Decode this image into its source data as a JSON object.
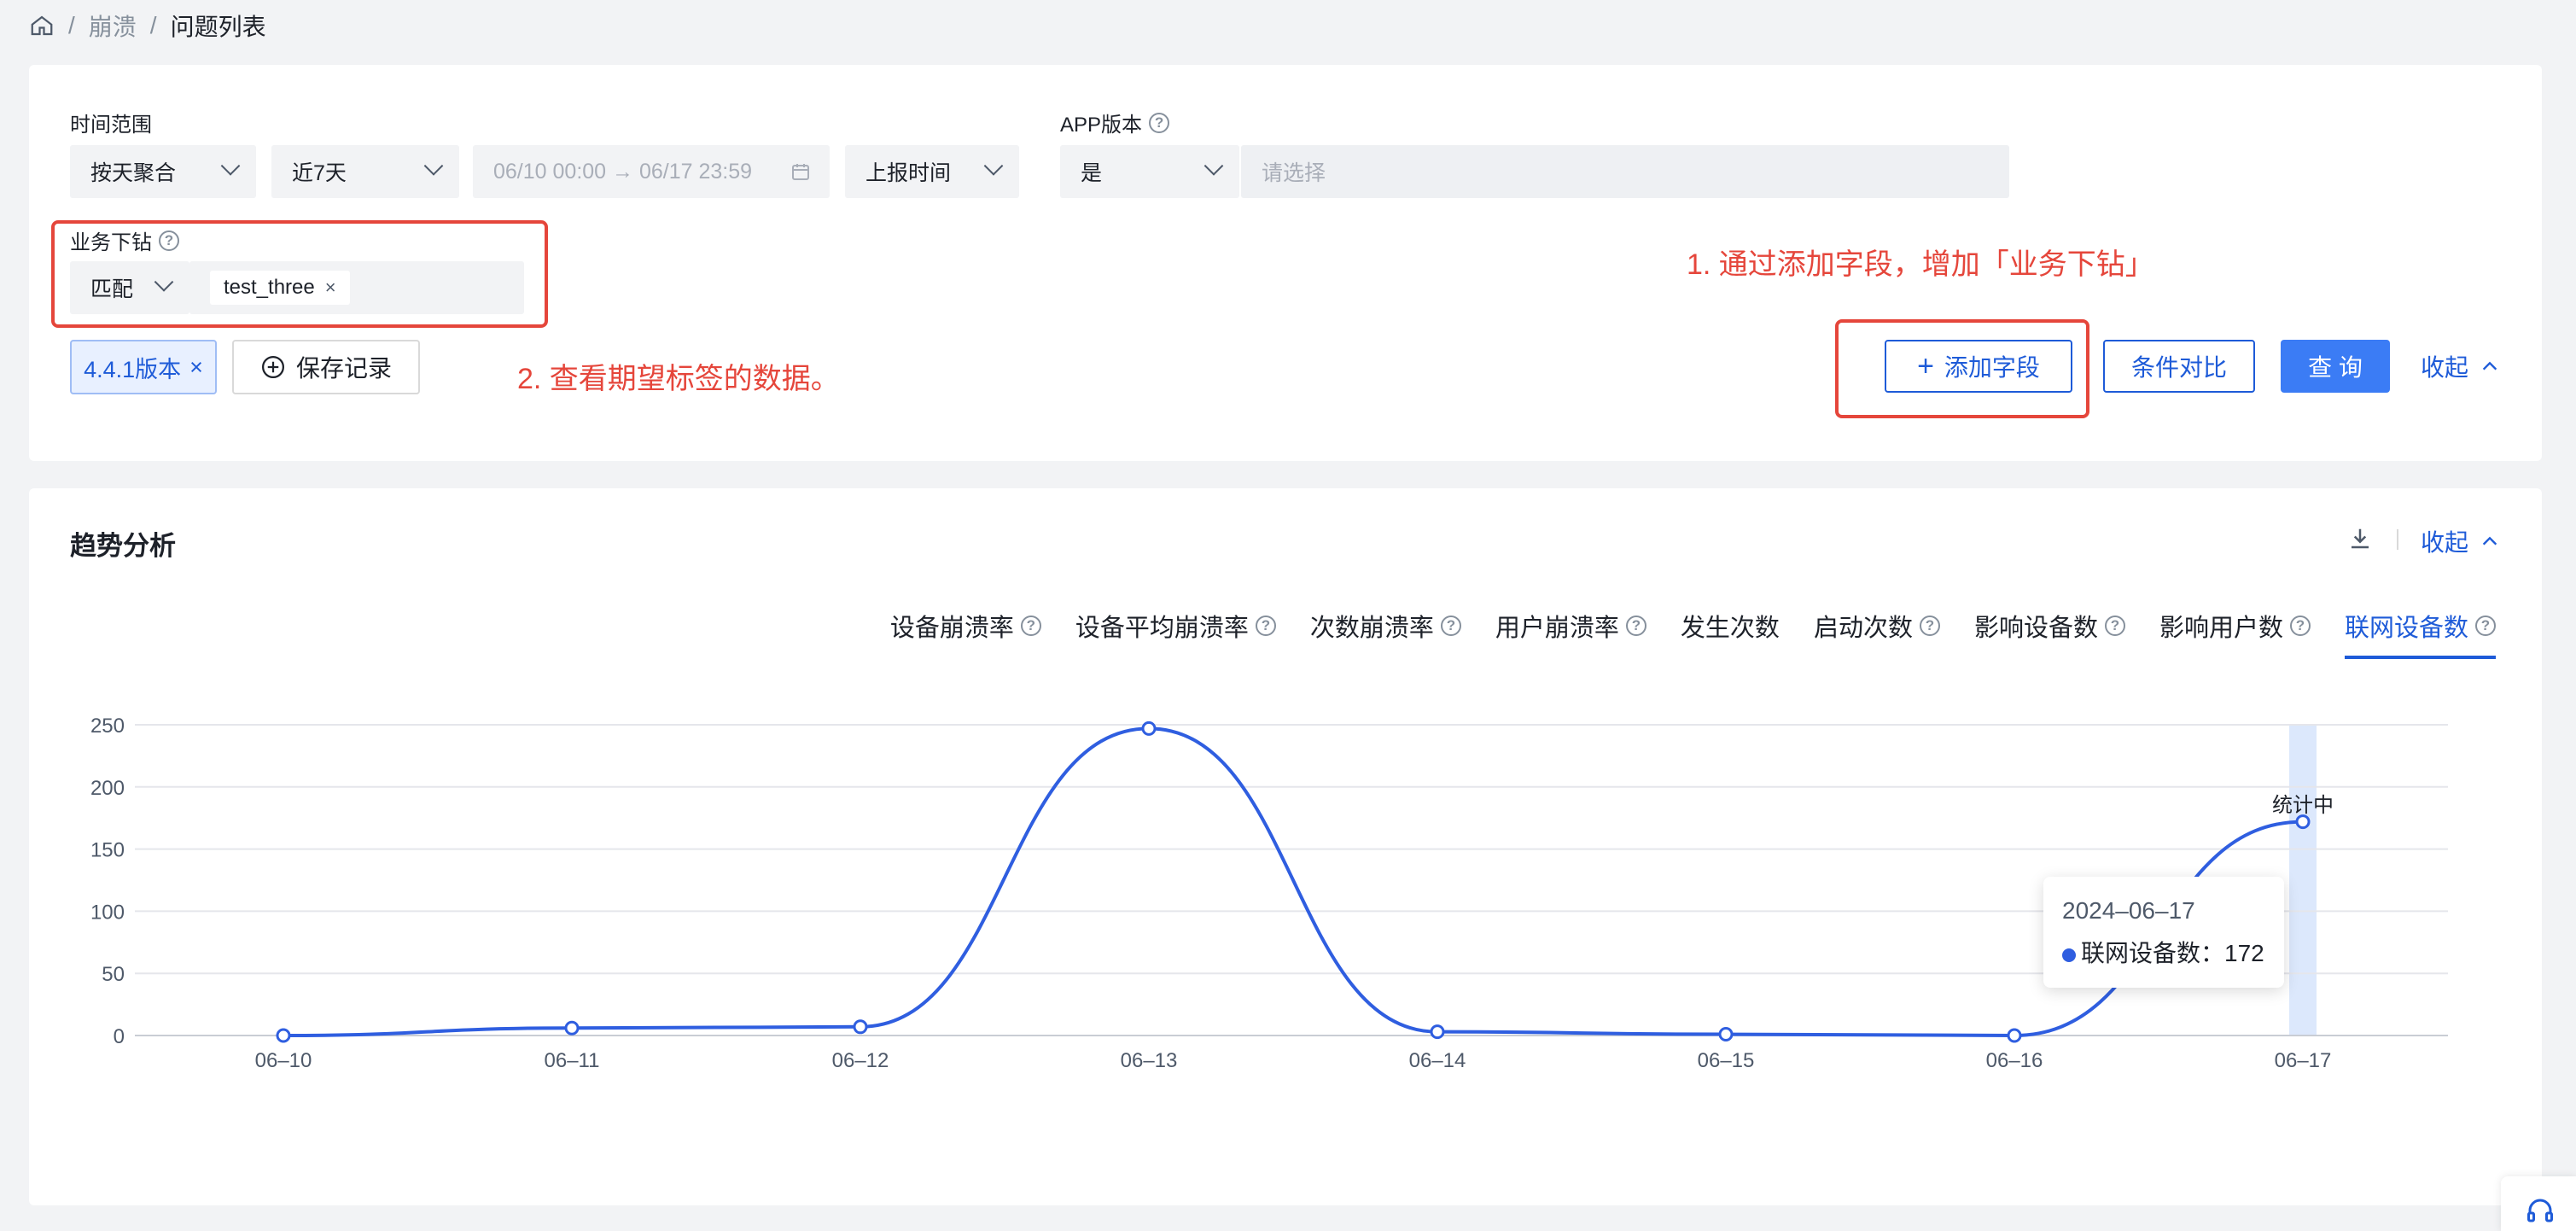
{
  "breadcrumb": {
    "items": [
      "崩溃",
      "问题列表"
    ],
    "separator": "/"
  },
  "filters": {
    "time_range_label": "时间范围",
    "aggregation": "按天聚合",
    "range_preset": "近7天",
    "date_range": "06/10 00:00 → 06/17 23:59",
    "time_type": "上报时间",
    "app_version_label": "APP版本",
    "app_version_op": "是",
    "app_version_placeholder": "请选择",
    "drill_label": "业务下钻",
    "drill_op": "匹配",
    "drill_tag": "test_three",
    "saved_tag": "4.4.1版本",
    "save_record": "保存记录",
    "add_field": "添加字段",
    "compare": "条件对比",
    "query": "查 询",
    "collapse": "收起"
  },
  "annotations": {
    "note1": "1. 通过添加字段，增加「业务下钻」",
    "note2": "2. 查看期望标签的数据。"
  },
  "trend": {
    "title": "趋势分析",
    "collapse": "收起",
    "tabs": [
      "设备崩溃率",
      "设备平均崩溃率",
      "次数崩溃率",
      "用户崩溃率",
      "发生次数",
      "启动次数",
      "影响设备数",
      "影响用户数",
      "联网设备数"
    ],
    "tabs_help": [
      true,
      true,
      true,
      true,
      false,
      true,
      true,
      true,
      true
    ],
    "active_tab": 8,
    "pending_label": "统计中",
    "tooltip": {
      "date": "2024–06–17",
      "series": "联网设备数：",
      "value": "172"
    }
  },
  "chart_data": {
    "type": "line",
    "categories": [
      "06–10",
      "06–11",
      "06–12",
      "06–13",
      "06–14",
      "06–15",
      "06–16",
      "06–17"
    ],
    "series": [
      {
        "name": "联网设备数",
        "values": [
          0,
          6,
          7,
          247,
          3,
          1,
          0,
          172
        ]
      }
    ],
    "ylim": [
      0,
      250
    ],
    "yticks": [
      0,
      50,
      100,
      150,
      200,
      250
    ],
    "grid": true,
    "color": "#2f5ee0",
    "highlight_index": 7
  },
  "colors": {
    "primary": "#1e5bd8",
    "annotation": "#e5463b"
  }
}
